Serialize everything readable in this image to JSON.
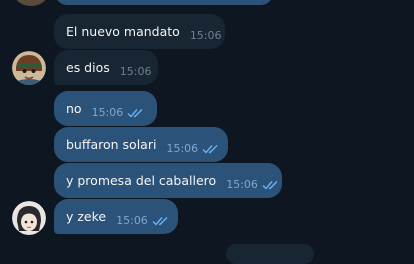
{
  "messages": [
    {
      "text": "El nuevo mandato",
      "time": "15:06",
      "direction": "in"
    },
    {
      "text": "es dios",
      "time": "15:06",
      "direction": "in"
    },
    {
      "text": "no",
      "time": "15:06",
      "direction": "out",
      "status": "read"
    },
    {
      "text": "buffaron solari",
      "time": "15:06",
      "direction": "out",
      "status": "read"
    },
    {
      "text": "y promesa del caballero",
      "time": "15:06",
      "direction": "out",
      "status": "read"
    },
    {
      "text": "y zeke",
      "time": "15:06",
      "direction": "out",
      "status": "read"
    }
  ],
  "icons": {
    "read_receipt": "double-check-icon",
    "avatar_top": "user-avatar-icon",
    "avatar_bottom": "user-avatar-icon"
  },
  "colors": {
    "background": "#0e1621",
    "incoming_bubble": "#182533",
    "outgoing_bubble": "#2b5278",
    "read_check": "#6ab3f3"
  }
}
